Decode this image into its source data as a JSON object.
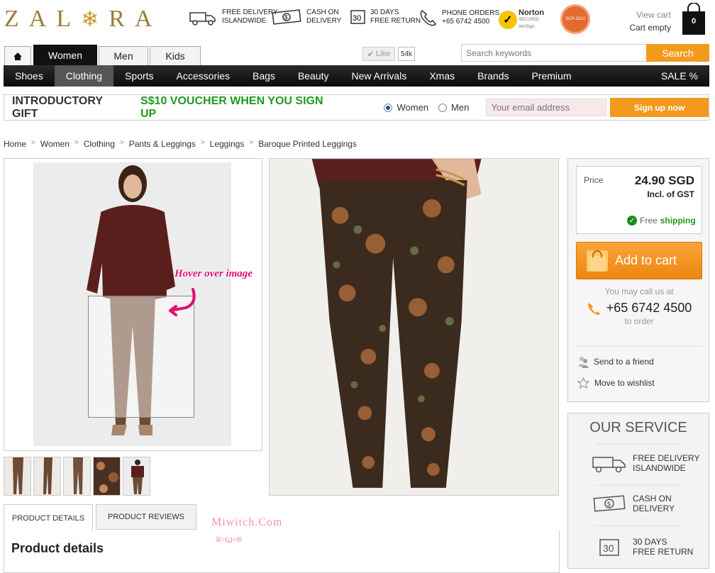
{
  "brand": {
    "logo_left": "ZAL",
    "logo_right": "RA",
    "flake": "❄"
  },
  "usps": [
    {
      "line1": "Free delivery",
      "line2": "islandwide",
      "icon": "truck-icon"
    },
    {
      "line1": "Cash on",
      "line2": "delivery",
      "icon": "cash-icon"
    },
    {
      "line1": "30 days",
      "line2": "free return",
      "icon": "return-icon"
    },
    {
      "line1": "Phone orders",
      "line2": "+65 6742 4500",
      "icon": "phone-icon"
    }
  ],
  "badges": {
    "norton": "Norton",
    "norton_sub": "SECURED",
    "norton_sub2": "VeriSign",
    "seal": "SCP-2012"
  },
  "cart": {
    "view": "View cart",
    "status": "Cart empty",
    "count": "0"
  },
  "gender_tabs": [
    "Women",
    "Men",
    "Kids"
  ],
  "facebook": {
    "like": "Like",
    "count": "54k"
  },
  "search": {
    "placeholder": "Search keywords",
    "button": "Search"
  },
  "nav": [
    "Shoes",
    "Clothing",
    "Sports",
    "Accessories",
    "Bags",
    "Beauty",
    "New Arrivals",
    "Xmas",
    "Brands",
    "Premium"
  ],
  "nav_sale": "SALE %",
  "gift": {
    "title": "INTRODUCTORY GIFT",
    "voucher": "S$10 VOUCHER WHEN YOU SIGN UP",
    "opt_women": "Women",
    "opt_men": "Men",
    "email_placeholder": "Your email address",
    "signup": "Sign up now"
  },
  "breadcrumb": [
    "Home",
    "Women",
    "Clothing",
    "Pants & Leggings",
    "Leggings",
    "Baroque Printed Leggings"
  ],
  "hover_note": "Hover over image",
  "product_tabs": {
    "details": "PRODUCT DETAILS",
    "reviews": "PRODUCT REVIEWS"
  },
  "details_title": "Product details",
  "watermark": {
    "text": "Miwitch.Com",
    "face": "≡◦ω◦≡"
  },
  "price": {
    "label": "Price",
    "value": "24.90 SGD",
    "gst": "Incl. of GST",
    "free": "Free",
    "shipping": "shipping"
  },
  "add_to_cart": "Add to cart",
  "call": {
    "note": "You may call us at",
    "number": "+65 6742 4500",
    "order": "to order"
  },
  "actions": {
    "send": "Send to a friend",
    "wishlist": "Move to wishlist"
  },
  "service": {
    "title": "OUR SERVICE",
    "items": [
      {
        "line1": "Free delivery",
        "line2": "islandwide"
      },
      {
        "line1": "Cash on",
        "line2": "delivery"
      },
      {
        "line1": "30 days",
        "line2": "free return"
      }
    ]
  },
  "colors": {
    "accent": "#f39a1e",
    "brand_gold": "#9b7d3a",
    "green": "#1f9a1f",
    "nav_bg": "#111111"
  }
}
